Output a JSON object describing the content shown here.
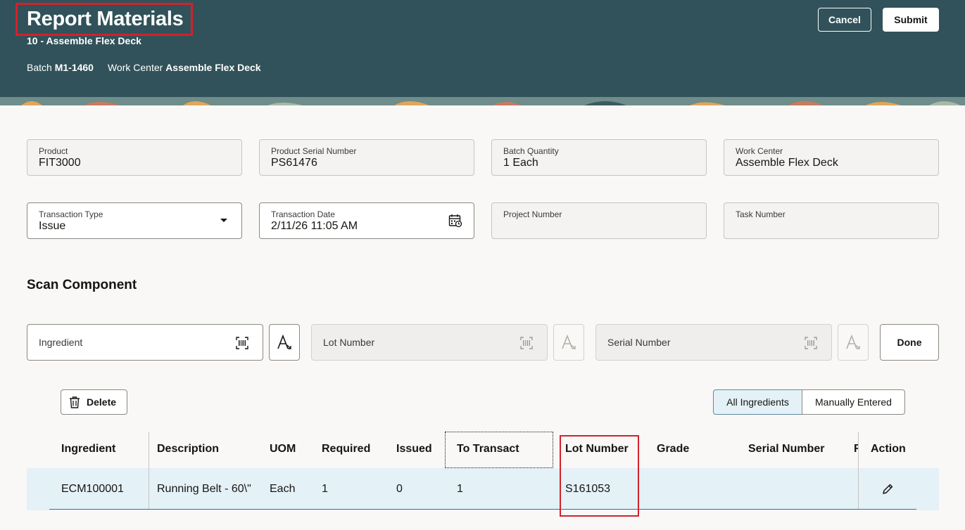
{
  "header": {
    "title": "Report Materials",
    "operation": "10 - Assemble Flex Deck",
    "batch_label": "Batch",
    "batch_value": "M1-1460",
    "work_center_label": "Work Center",
    "work_center_value": "Assemble Flex Deck",
    "cancel_label": "Cancel",
    "submit_label": "Submit"
  },
  "fields": {
    "product": {
      "label": "Product",
      "value": "FIT3000"
    },
    "serial": {
      "label": "Product Serial Number",
      "value": "PS61476"
    },
    "batch_qty": {
      "label": "Batch Quantity",
      "value": "1 Each"
    },
    "work_center": {
      "label": "Work Center",
      "value": "Assemble Flex Deck"
    },
    "transaction_type": {
      "label": "Transaction Type",
      "value": "Issue"
    },
    "transaction_date": {
      "label": "Transaction Date",
      "value": "2/11/26 11:05 AM"
    },
    "project_number": {
      "label": "Project Number",
      "value": ""
    },
    "task_number": {
      "label": "Task Number",
      "value": ""
    }
  },
  "scan": {
    "section_title": "Scan Component",
    "ingredient_placeholder": "Ingredient",
    "lot_placeholder": "Lot Number",
    "serial_placeholder": "Serial Number",
    "done_label": "Done"
  },
  "toolbar": {
    "delete_label": "Delete",
    "all_ingredients_label": "All Ingredients",
    "manually_entered_label": "Manually Entered"
  },
  "table": {
    "columns": [
      "Ingredient",
      "Description",
      "UOM",
      "Required",
      "Issued",
      "To Transact",
      "Lot Number",
      "Grade",
      "Serial Number",
      "R",
      "Action"
    ],
    "rows": [
      {
        "ingredient": "ECM100001",
        "description": "Running Belt - 60\\\"",
        "uom": "Each",
        "required": "1",
        "issued": "0",
        "to_transact": "1",
        "lot_number": "S161053",
        "grade": "",
        "serial_number": ""
      }
    ]
  },
  "colors": {
    "header_bg": "#31525a",
    "highlight": "#d1222b",
    "selected_row": "#e4f1f7"
  }
}
